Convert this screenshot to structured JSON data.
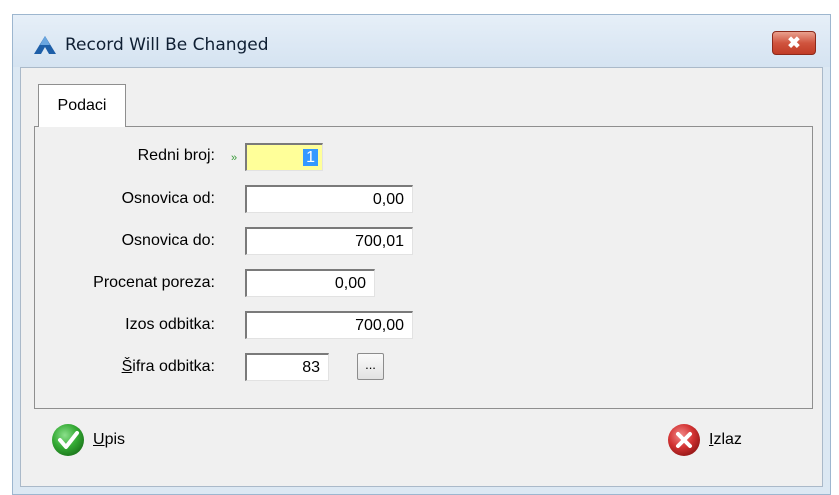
{
  "window": {
    "title": "Record Will Be Changed",
    "close_label": "✖"
  },
  "tabs": [
    {
      "label": "Podaci"
    }
  ],
  "form": {
    "redni_broj": {
      "label": "Redni broj:",
      "value": "1",
      "marker": "»"
    },
    "osnovica_od": {
      "label": "Osnovica od:",
      "value": "0,00"
    },
    "osnovica_do": {
      "label": "Osnovica do:",
      "value": "700,01"
    },
    "procenat_poreza": {
      "label": "Procenat poreza:",
      "value": "0,00"
    },
    "izos_odbitka": {
      "label": "Izos odbitka:",
      "value": "700,00"
    },
    "sifra_odbitka": {
      "label_key": "Š",
      "label_rest": "ifra odbitka:",
      "value": "83",
      "browse_label": "..."
    }
  },
  "buttons": {
    "upis": {
      "key": "U",
      "rest": "pis"
    },
    "izlaz": {
      "key": "I",
      "rest": "zlaz"
    }
  },
  "colors": {
    "active_field": "#ffff99",
    "selection": "#3399ff",
    "close_button": "#c94a33",
    "ok_icon": "#2fa52f",
    "cancel_icon": "#c62828"
  },
  "icons": {
    "app": "blue-triangle-logo-icon",
    "ok": "green-check-icon",
    "cancel": "red-x-icon"
  }
}
